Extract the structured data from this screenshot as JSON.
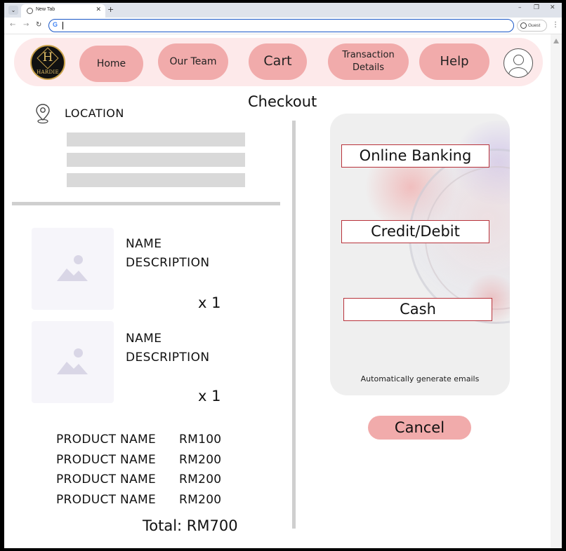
{
  "browser": {
    "tab_title": "New Tab",
    "address": "",
    "profile_label": "Guest"
  },
  "navbar": {
    "logo_letter": "H",
    "logo_text": "HARDIE",
    "home": "Home",
    "team": "Our Team",
    "cart": "Cart",
    "transactions_line1": "Transaction",
    "transactions_line2": "Details",
    "help": "Help"
  },
  "checkout": {
    "title": "Checkout",
    "location_label": "LOCATION",
    "items": [
      {
        "name": "NAME",
        "description": "DESCRIPTION",
        "qty": "x 1"
      },
      {
        "name": "NAME",
        "description": "DESCRIPTION",
        "qty": "x 1"
      }
    ],
    "summary": [
      {
        "product": "PRODUCT NAME",
        "price": "RM100"
      },
      {
        "product": "PRODUCT NAME",
        "price": "RM200"
      },
      {
        "product": "PRODUCT NAME",
        "price": "RM200"
      },
      {
        "product": "PRODUCT NAME",
        "price": "RM200"
      }
    ],
    "total": "Total: RM700"
  },
  "payment": {
    "online_banking": "Online Banking",
    "credit_debit": "Credit/Debit",
    "cash": "Cash",
    "note": "Automatically generate emails",
    "cancel": "Cancel"
  },
  "colors": {
    "navbar_bg": "#fde9ea",
    "button_pink": "#f1abab",
    "payment_border": "#b8323a",
    "panel_bg": "#efefef"
  }
}
